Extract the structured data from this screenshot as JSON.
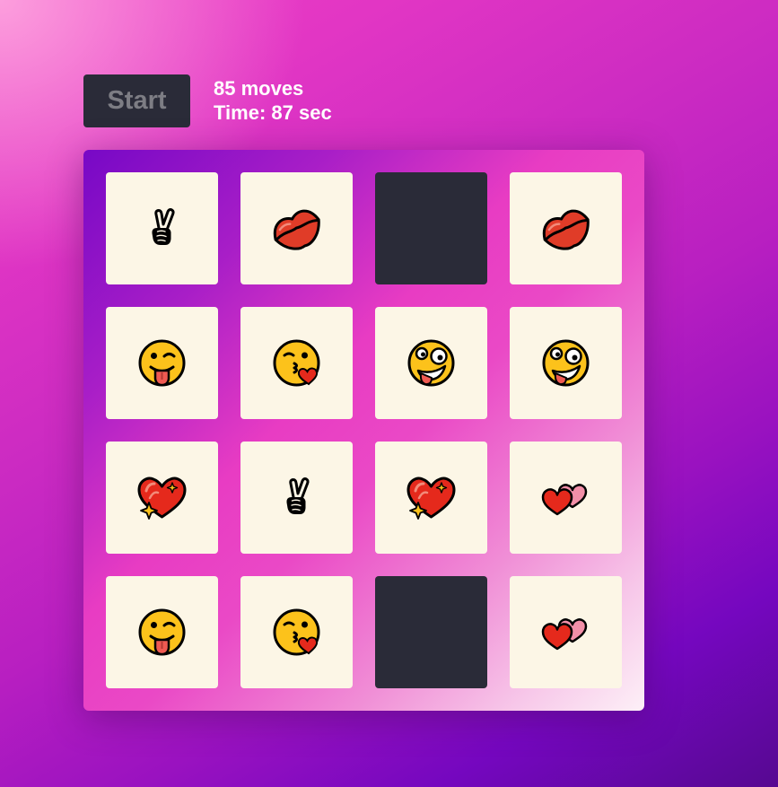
{
  "controls": {
    "start_label": "Start",
    "moves_text": "85 moves",
    "time_text": "Time: 87 sec"
  },
  "board": {
    "rows": 4,
    "columns": 4,
    "cards": [
      {
        "emoji": "victory-hand-icon",
        "state": "flipped"
      },
      {
        "emoji": "kiss-mark-icon",
        "state": "flipped"
      },
      {
        "emoji": null,
        "state": "hidden"
      },
      {
        "emoji": "kiss-mark-icon",
        "state": "flipped"
      },
      {
        "emoji": "winking-tongue-face-icon",
        "state": "flipped"
      },
      {
        "emoji": "face-blowing-kiss-icon",
        "state": "flipped"
      },
      {
        "emoji": "zany-face-icon",
        "state": "flipped"
      },
      {
        "emoji": "zany-face-icon",
        "state": "flipped"
      },
      {
        "emoji": "sparkling-heart-icon",
        "state": "flipped"
      },
      {
        "emoji": "victory-hand-icon",
        "state": "flipped"
      },
      {
        "emoji": "sparkling-heart-icon",
        "state": "flipped"
      },
      {
        "emoji": "two-hearts-icon",
        "state": "flipped"
      },
      {
        "emoji": "winking-tongue-face-icon",
        "state": "flipped"
      },
      {
        "emoji": "face-blowing-kiss-icon",
        "state": "flipped"
      },
      {
        "emoji": null,
        "state": "hidden"
      },
      {
        "emoji": "two-hearts-icon",
        "state": "flipped"
      }
    ]
  },
  "colors": {
    "card_face": "#fcf6e6",
    "card_back": "#2a2b38",
    "button_bg": "#2a2b38",
    "button_text": "#7d7d84",
    "stats_text": "#ffffff"
  }
}
